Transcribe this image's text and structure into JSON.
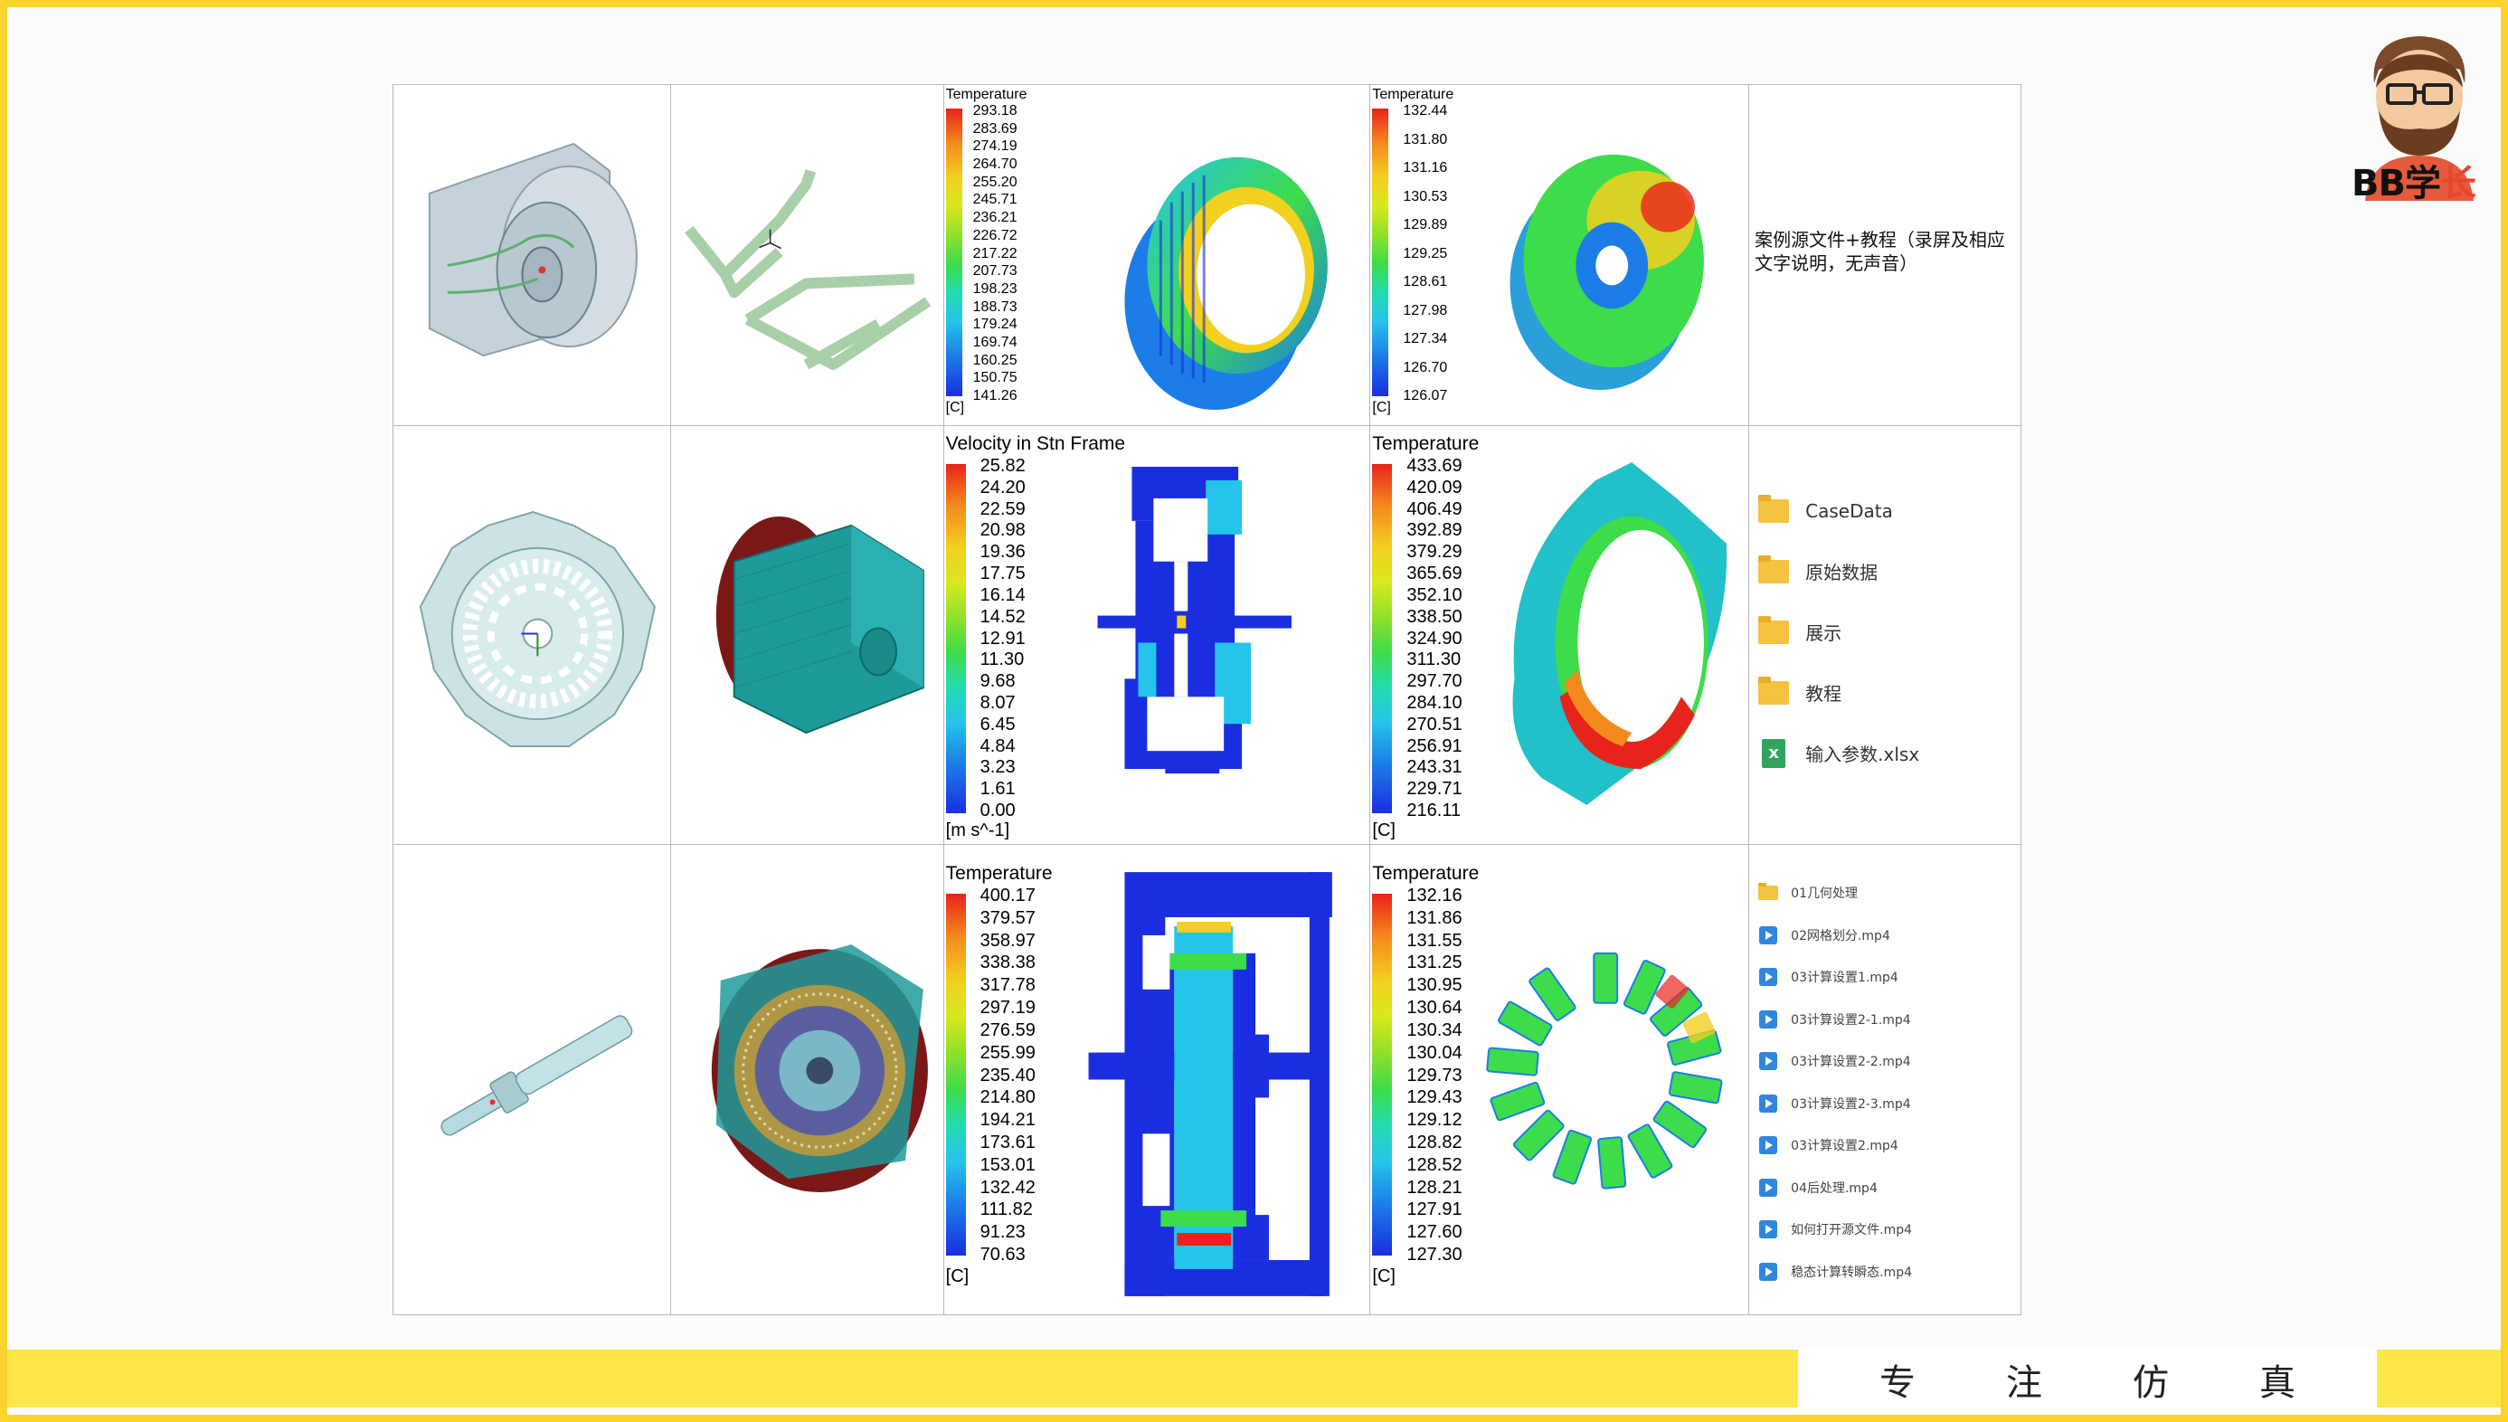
{
  "brand": {
    "logo_text": "BB学",
    "logo_accent": "长",
    "accent_color": "#fad32e"
  },
  "footer": {
    "slogan": [
      "专",
      "注",
      "仿",
      "真"
    ]
  },
  "row1": {
    "legend_a": {
      "title": "Temperature",
      "unit": "[C]",
      "values": [
        "293.18",
        "283.69",
        "274.19",
        "264.70",
        "255.20",
        "245.71",
        "236.21",
        "226.72",
        "217.22",
        "207.73",
        "198.23",
        "188.73",
        "179.24",
        "169.74",
        "160.25",
        "150.75",
        "141.26"
      ]
    },
    "legend_b": {
      "title": "Temperature",
      "unit": "[C]",
      "values": [
        "132.44",
        "131.80",
        "131.16",
        "130.53",
        "129.89",
        "129.25",
        "128.61",
        "127.98",
        "127.34",
        "126.70",
        "126.07"
      ]
    },
    "note": "案例源文件+教程（录屏及相应文字说明，无声音）"
  },
  "row2": {
    "legend_a": {
      "title": "Velocity in Stn Frame",
      "unit": "[m s^-1]",
      "values": [
        "25.82",
        "24.20",
        "22.59",
        "20.98",
        "19.36",
        "17.75",
        "16.14",
        "14.52",
        "12.91",
        "11.30",
        "9.68",
        "8.07",
        "6.45",
        "4.84",
        "3.23",
        "1.61",
        "0.00"
      ]
    },
    "legend_b": {
      "title": "Temperature",
      "unit": "[C]",
      "values": [
        "433.69",
        "420.09",
        "406.49",
        "392.89",
        "379.29",
        "365.69",
        "352.10",
        "338.50",
        "324.90",
        "311.30",
        "297.70",
        "284.10",
        "270.51",
        "256.91",
        "243.31",
        "229.71",
        "216.11"
      ]
    },
    "files": [
      {
        "type": "folder",
        "name": "CaseData"
      },
      {
        "type": "folder",
        "name": "原始数据"
      },
      {
        "type": "folder",
        "name": "展示"
      },
      {
        "type": "folder",
        "name": "教程"
      },
      {
        "type": "xlsx",
        "name": "输入参数.xlsx"
      }
    ]
  },
  "row3": {
    "legend_a": {
      "title": "Temperature",
      "unit": "[C]",
      "values": [
        "400.17",
        "379.57",
        "358.97",
        "338.38",
        "317.78",
        "297.19",
        "276.59",
        "255.99",
        "235.40",
        "214.80",
        "194.21",
        "173.61",
        "153.01",
        "132.42",
        "111.82",
        "91.23",
        "70.63"
      ]
    },
    "legend_b": {
      "title": "Temperature",
      "unit": "[C]",
      "values": [
        "132.16",
        "131.86",
        "131.55",
        "131.25",
        "130.95",
        "130.64",
        "130.34",
        "130.04",
        "129.73",
        "129.43",
        "129.12",
        "128.82",
        "128.52",
        "128.21",
        "127.91",
        "127.60",
        "127.30"
      ]
    },
    "files": [
      {
        "type": "folder",
        "name": "01几何处理"
      },
      {
        "type": "video",
        "name": "02网格划分.mp4"
      },
      {
        "type": "video",
        "name": "03计算设置1.mp4"
      },
      {
        "type": "video",
        "name": "03计算设置2-1.mp4"
      },
      {
        "type": "video",
        "name": "03计算设置2-2.mp4"
      },
      {
        "type": "video",
        "name": "03计算设置2-3.mp4"
      },
      {
        "type": "video",
        "name": "03计算设置2.mp4"
      },
      {
        "type": "video",
        "name": "04后处理.mp4"
      },
      {
        "type": "video",
        "name": "如何打开源文件.mp4"
      },
      {
        "type": "video",
        "name": "稳态计算转瞬态.mp4"
      }
    ]
  }
}
